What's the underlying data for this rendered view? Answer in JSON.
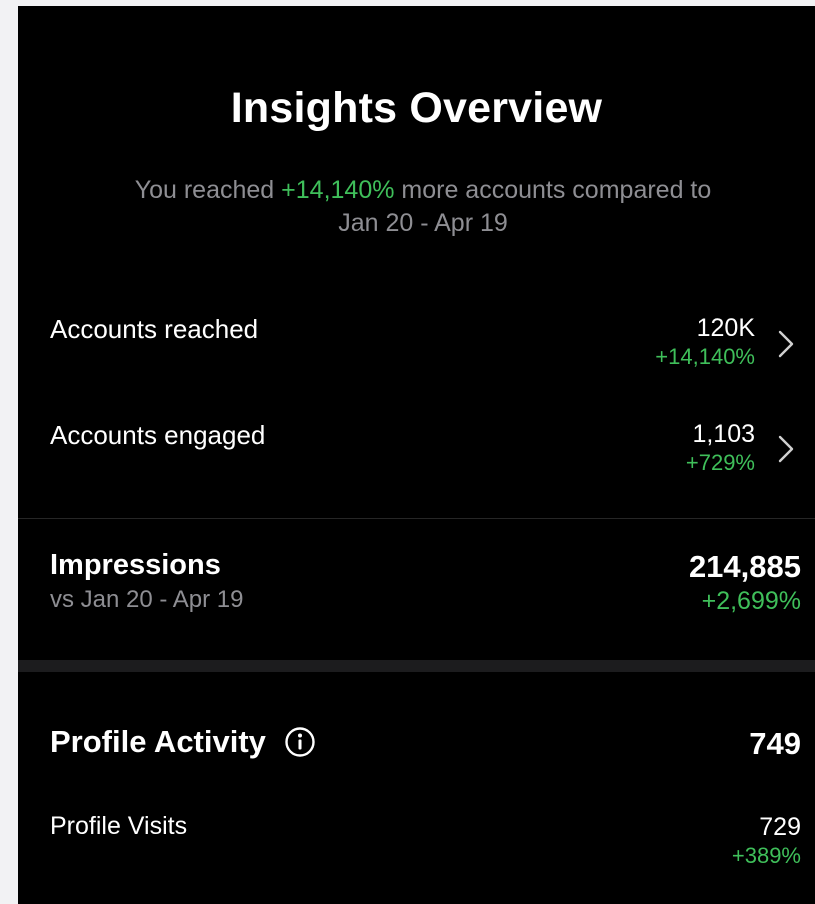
{
  "header": {
    "title": "Insights Overview",
    "subtitle_prefix": "You reached ",
    "subtitle_highlight": "+14,140%",
    "subtitle_suffix": " more accounts compared to",
    "subtitle_range": "Jan 20 - Apr 19"
  },
  "metrics": [
    {
      "label": "Accounts reached",
      "value": "120K",
      "change": "+14,140%",
      "icon": "chevron-right-icon"
    },
    {
      "label": "Accounts engaged",
      "value": "1,103",
      "change": "+729%",
      "icon": "chevron-right-icon"
    }
  ],
  "impressions": {
    "label": "Impressions",
    "sublabel": "vs Jan 20 - Apr 19",
    "value": "214,885",
    "change": "+2,699%"
  },
  "profile_activity": {
    "label": "Profile Activity",
    "icon": "info-icon",
    "value": "749",
    "visits_label": "Profile Visits",
    "visits_value": "729",
    "visits_change": "+389%"
  },
  "colors": {
    "background": "#000000",
    "positive": "#3fbf5a",
    "secondary_text": "#8e8e93"
  }
}
